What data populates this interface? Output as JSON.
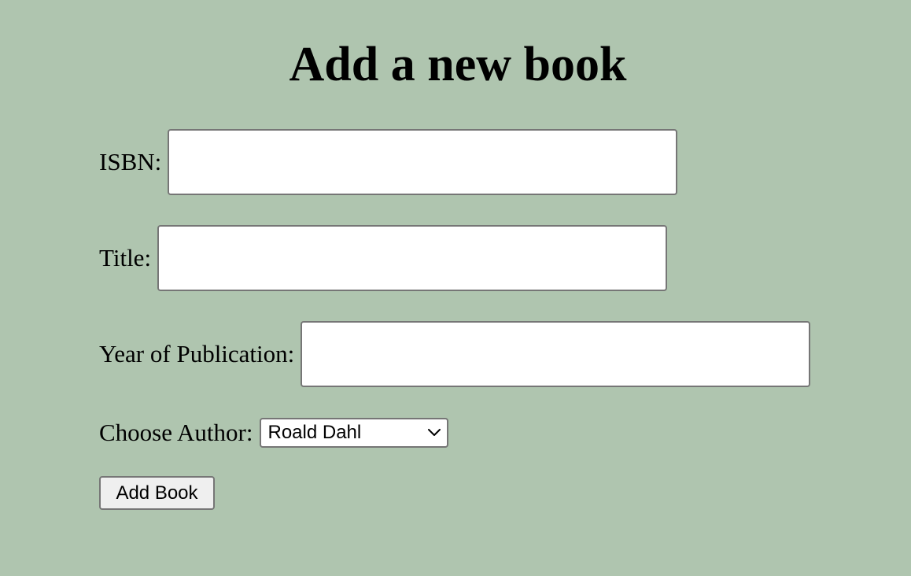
{
  "page": {
    "title": "Add a new book"
  },
  "form": {
    "isbn": {
      "label": "ISBN:",
      "value": "",
      "placeholder": ""
    },
    "title": {
      "label": "Title:",
      "value": "",
      "placeholder": ""
    },
    "year": {
      "label": "Year of Publication:",
      "value": "",
      "placeholder": ""
    },
    "author": {
      "label": "Choose Author:",
      "selected": "Roald Dahl"
    },
    "submit_label": "Add Book"
  },
  "colors": {
    "background": "#afc5af",
    "input_border": "#767676",
    "button_bg": "#efefef"
  },
  "icons": {
    "author_select": "chevron-down-icon"
  }
}
